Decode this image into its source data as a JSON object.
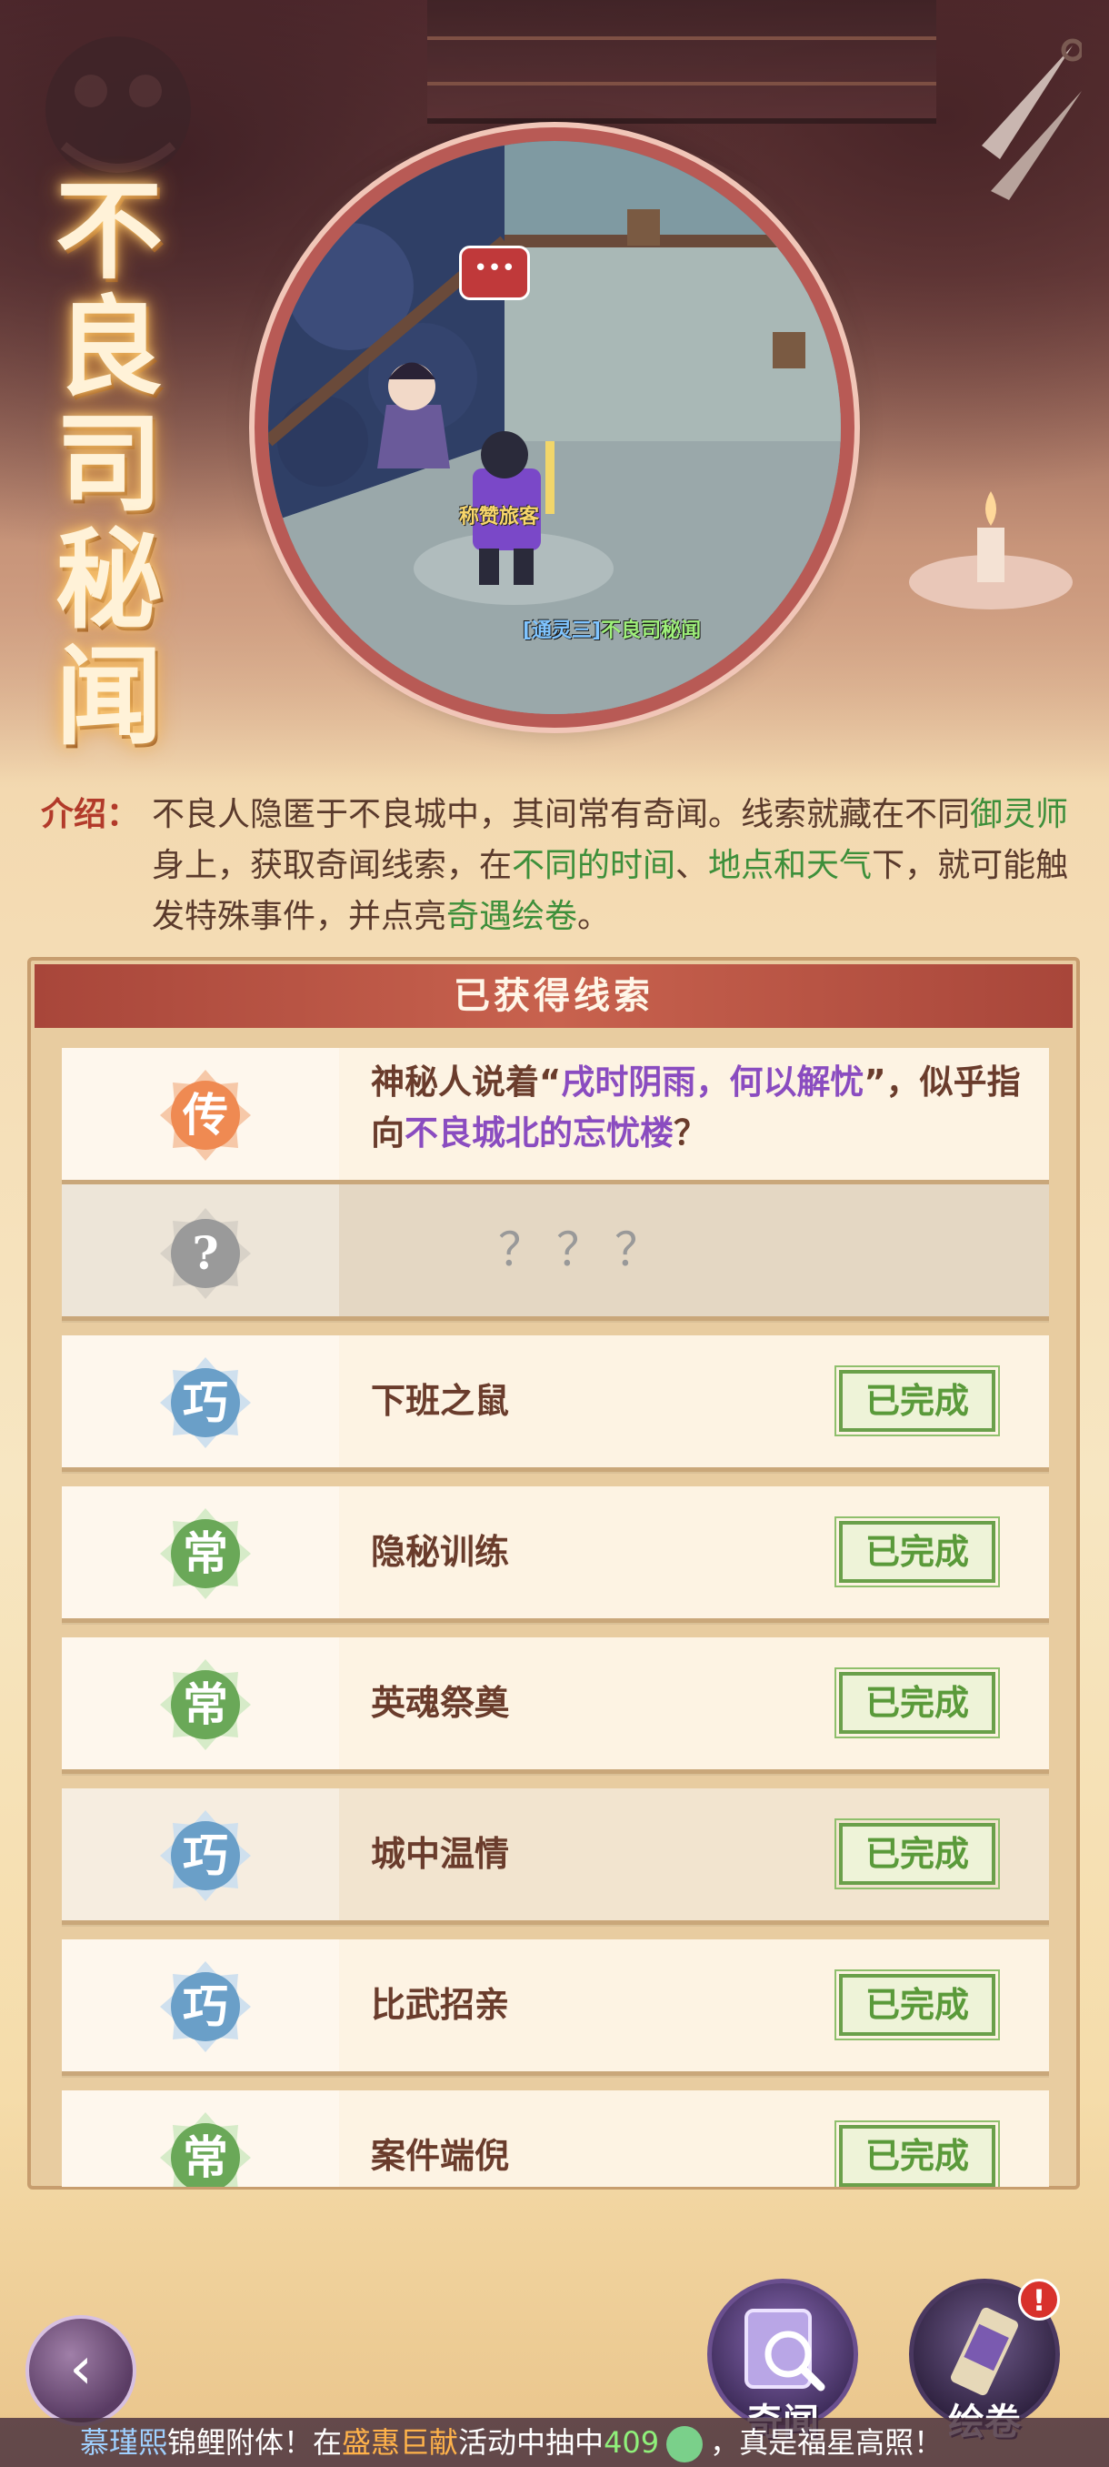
{
  "banner": {
    "title_chars": [
      "不",
      "良",
      "司",
      "秘",
      "闻"
    ],
    "bubble": "•••",
    "npc_name": "称赞旅客",
    "player_tag": "[通灵三]",
    "player_name": "不良司秘闻"
  },
  "intro": {
    "label": "介绍：",
    "parts": [
      "不良人隐匿于不良城中，其间常有奇闻。线索就藏在不同",
      "御灵师",
      "身上，获取奇闻线索，在",
      "不同的时间",
      "、",
      "地点和天气",
      "下，就可能触发特殊事件，并点亮",
      "奇遇绘卷",
      "。"
    ]
  },
  "panel": {
    "title": "已获得线索",
    "clue_row": {
      "badge": "传",
      "desc_prefix": "神秘人说着“",
      "desc_phrase": "戌时阴雨，何以解忧",
      "desc_mid": "”，似乎指向",
      "desc_place": "不良城北的忘忧楼",
      "desc_suffix": "？"
    },
    "unknown_row": {
      "badge": "?",
      "text": "？？？"
    },
    "done_label": "已完成",
    "items": [
      {
        "badge": "巧",
        "badge_type": "qiao",
        "title": "下班之鼠"
      },
      {
        "badge": "常",
        "badge_type": "chang",
        "title": "隐秘训练"
      },
      {
        "badge": "常",
        "badge_type": "chang",
        "title": "英魂祭奠"
      },
      {
        "badge": "巧",
        "badge_type": "qiao",
        "title": "城中温情"
      },
      {
        "badge": "巧",
        "badge_type": "qiao",
        "title": "比武招亲"
      },
      {
        "badge": "常",
        "badge_type": "chang",
        "title": "案件端倪"
      }
    ]
  },
  "bottom": {
    "back_icon": "‹",
    "qiwen_label": "奇闻",
    "huijuan_label": "绘卷",
    "alert": "!"
  },
  "ticker": {
    "name": "慕瑾熙",
    "t1": "锦鲤附体！在",
    "event": "盛惠巨献",
    "t2": "活动中抽中",
    "amount": "409",
    "t3": "，真是福星高照！"
  },
  "colors": {
    "badge_chuan": "#ef8a52",
    "badge_qiao": "#6a9fc8",
    "badge_chang": "#6aa858",
    "badge_unknown": "#9a9a9a",
    "done_green": "#5a9a3a"
  }
}
